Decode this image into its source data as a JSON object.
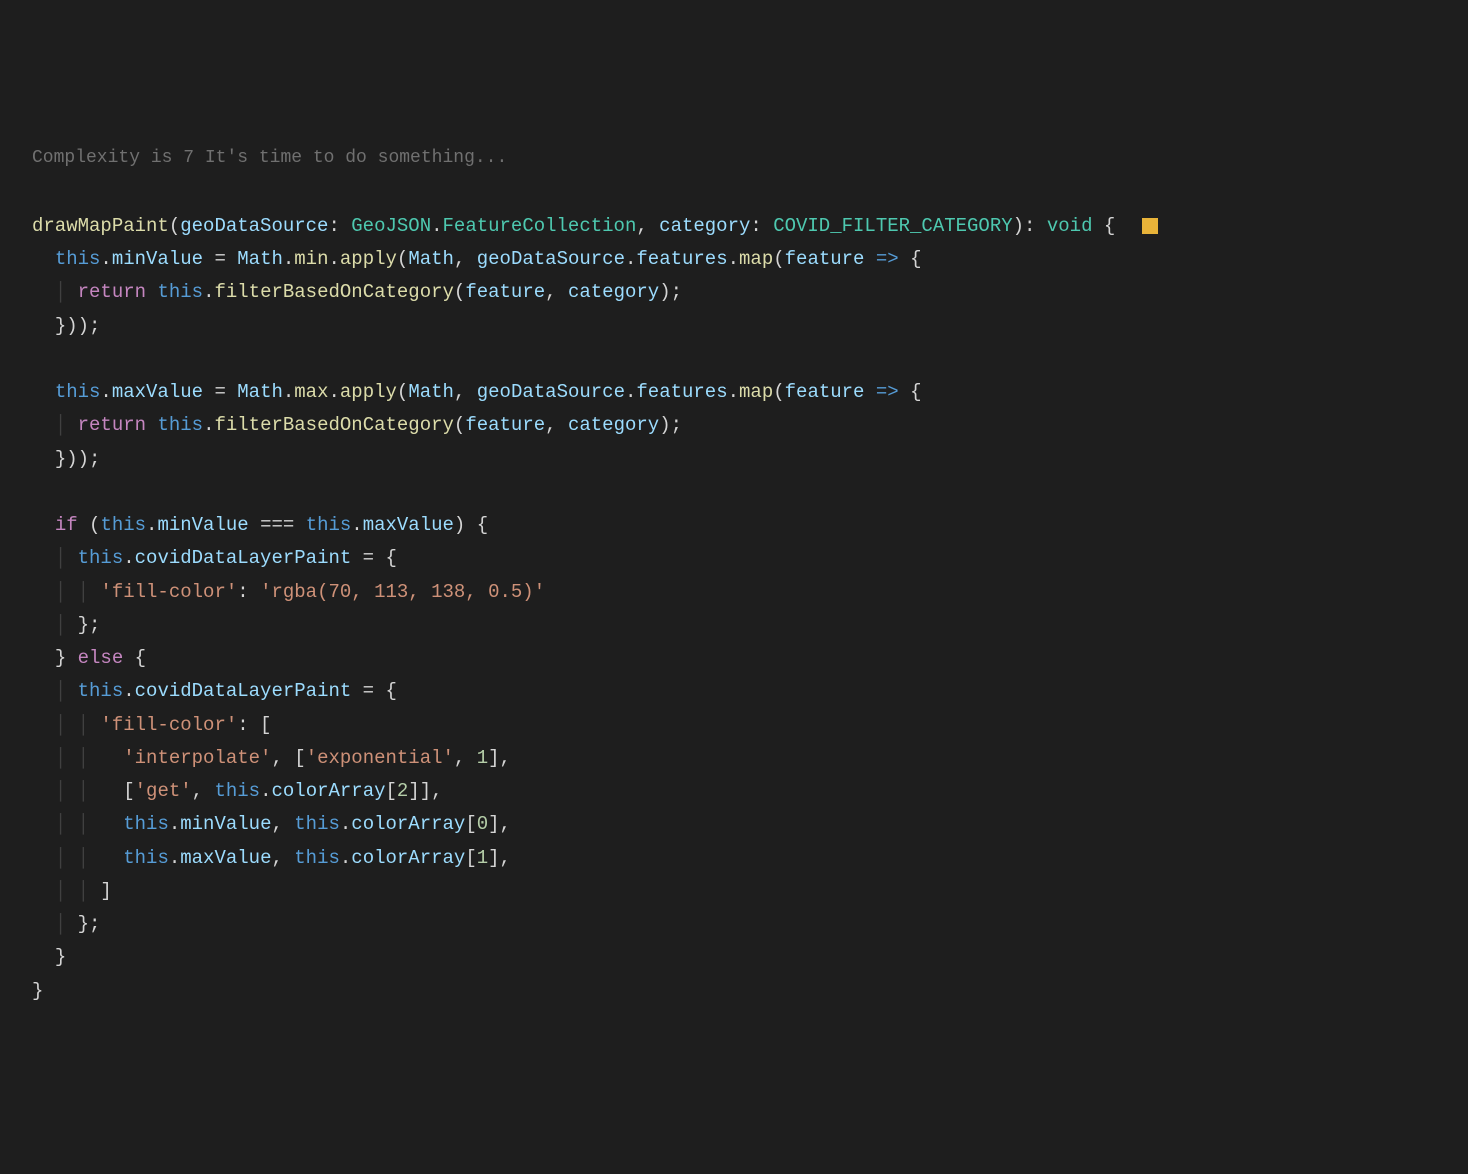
{
  "hint": "Complexity is 7 It's time to do something...",
  "sig": {
    "fn": "drawMapPaint",
    "p1": "geoDataSource",
    "t1a": "GeoJSON",
    "t1b": "FeatureCollection",
    "p2": "category",
    "t2": "COVID_FILTER_CATEGORY",
    "ret": "void"
  },
  "kw": {
    "this": "this",
    "return": "return",
    "if": "if",
    "else": "else"
  },
  "id": {
    "minValue": "minValue",
    "maxValue": "maxValue",
    "Math": "Math",
    "min": "min",
    "max": "max",
    "apply": "apply",
    "features": "features",
    "map": "map",
    "feature": "feature",
    "filterBasedOnCategory": "filterBasedOnCategory",
    "category": "category",
    "geoDataSource": "geoDataSource",
    "covidDataLayerPaint": "covidDataLayerPaint",
    "colorArray": "colorArray"
  },
  "str": {
    "fillColor": "'fill-color'",
    "rgba": "'rgba(70, 113, 138, 0.5)'",
    "interpolate": "'interpolate'",
    "exponential": "'exponential'",
    "get": "'get'"
  },
  "num": {
    "one": "1",
    "zero": "0",
    "two": "2"
  }
}
